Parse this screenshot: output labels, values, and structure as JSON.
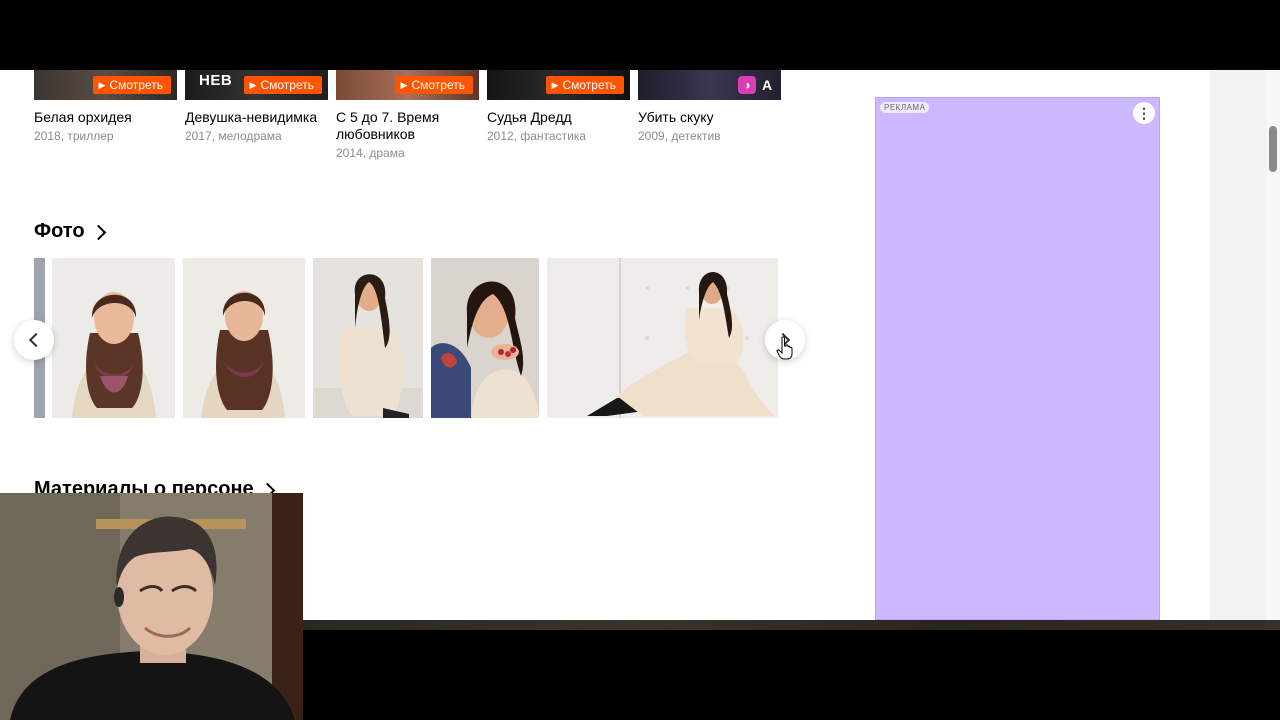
{
  "films": [
    {
      "title": "Белая орхидея",
      "meta": "2018, триллер",
      "watch_label": "Смотреть"
    },
    {
      "title": "Девушка-невидимка",
      "meta": "2017, мелодрама",
      "watch_label": "Смотреть",
      "poster_text": "НЕВ"
    },
    {
      "title": "С 5 до 7. Время любовников",
      "meta": "2014, драма",
      "watch_label": "Смотреть"
    },
    {
      "title": "Судья Дредд",
      "meta": "2012, фантастика",
      "watch_label": "Смотреть"
    },
    {
      "title": "Убить скуку",
      "meta": "2009, детектив",
      "badge_a": "A"
    }
  ],
  "photos_section": {
    "title": "Фото"
  },
  "materials_section": {
    "title": "Материалы о персоне"
  },
  "ad": {
    "label": "РЕКЛАМА",
    "menu_icon": "⋮"
  },
  "icons": {
    "play": "▶"
  },
  "colors": {
    "accent": "#ff5500",
    "ad_bg": "#cbb8ff",
    "meta_gray": "#8c8c8c"
  }
}
